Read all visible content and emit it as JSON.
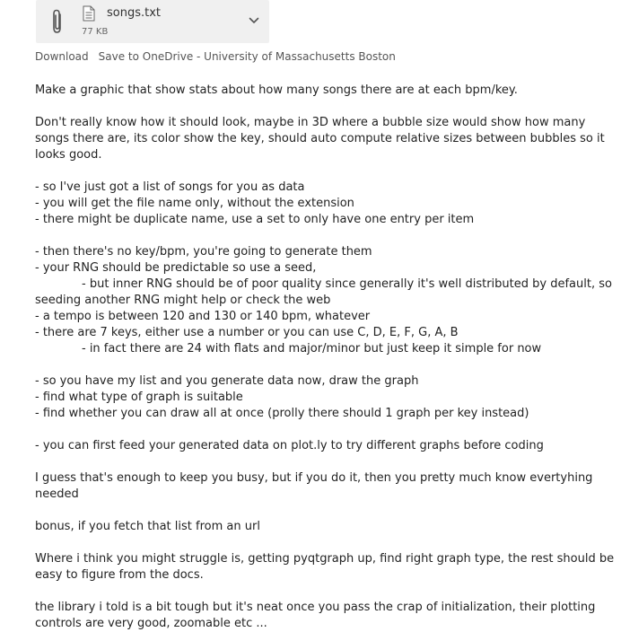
{
  "attachment": {
    "file_name": "songs.txt",
    "file_size": "77 KB",
    "icons": {
      "attachment": "paperclip-icon",
      "file": "text-file-icon",
      "expand": "chevron-down-icon"
    }
  },
  "actions": {
    "download": "Download",
    "save_onedrive": "Save to OneDrive - University of Massachusetts Boston"
  },
  "message": {
    "lines": [
      "Make a graphic that show stats about how many songs there are at each bpm/key.",
      "",
      "Don't really know how it should look, maybe in 3D where a bubble size would show how many songs there are, its color show the key, should auto compute relative sizes between bubbles so it looks good.",
      "",
      "- so I've just got a list of songs for you as data",
      "- you will get the file name only, without the extension",
      "- there might be duplicate name, use a set to only have one entry per item",
      "",
      "- then there's no key/bpm, you're going to generate them",
      "- your RNG should be predictable so use a seed,",
      "- but inner RNG should be of poor quality since generally it's well distributed by default, so seeding another RNG might help or check the web",
      "- a tempo is between 120 and 130 or 140 bpm, whatever",
      "- there are 7 keys, either use a number or you can use C, D, E, F, G, A, B",
      "- in fact there are 24 with flats and major/minor but just keep it simple for now",
      "",
      "- so you have my list and you generate data now, draw the graph",
      "- find what type of graph is suitable",
      "- find whether you can draw all at once (prolly there should 1 graph per key instead)",
      "",
      "- you can first feed your generated data on plot.ly to try different graphs before coding",
      "",
      "I guess that's enough to keep you busy, but if you do it, then you pretty much know evertyhing needed",
      "",
      "bonus, if you fetch that list from an url",
      "",
      "Where i think you might struggle is, getting pyqtgraph up, find right graph type, the rest should be easy to figure from the docs.",
      "",
      "the library i told is a bit tough but it's neat once you pass the crap of initialization, their plotting controls are very good, zoomable etc ..."
    ]
  }
}
